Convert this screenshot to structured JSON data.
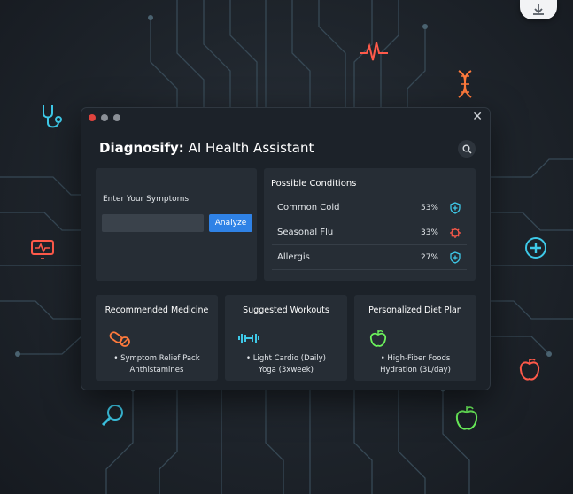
{
  "app": {
    "title_bold": "Diagnosify:",
    "title_rest": " AI Health Assistant"
  },
  "symptoms": {
    "label": "Enter Your Symptoms",
    "input_value": "",
    "analyze_label": "Analyze"
  },
  "conditions": {
    "title": "Possible Conditions",
    "items": [
      {
        "name": "Common Cold",
        "pct": "53%",
        "icon": "shield-plus-icon"
      },
      {
        "name": "Seasonal Flu",
        "pct": "33%",
        "icon": "virus-icon"
      },
      {
        "name": "Allergis",
        "pct": "27%",
        "icon": "shield-plus-icon"
      }
    ]
  },
  "cards": {
    "medicine": {
      "title": "Recommended Medicine",
      "icon": "pill-icon",
      "items": [
        "• Symptom Relief Pack",
        "Anthistamines"
      ]
    },
    "workouts": {
      "title": "Suggested Workouts",
      "icon": "dumbbell-icon",
      "items": [
        "• Light Cardio (Daily)",
        "Yoga (3xweek)"
      ]
    },
    "diet": {
      "title": "Personalized Diet Plan",
      "icon": "apple-icon",
      "items": [
        "• High-Fiber Foods",
        "Hydration (3L/day)"
      ]
    }
  },
  "colors": {
    "accent": "#2f82e6",
    "neon_cyan": "#3ec9e8",
    "neon_red": "#ff5a4a",
    "neon_green": "#6cf25c",
    "neon_orange": "#ff7a3c"
  }
}
